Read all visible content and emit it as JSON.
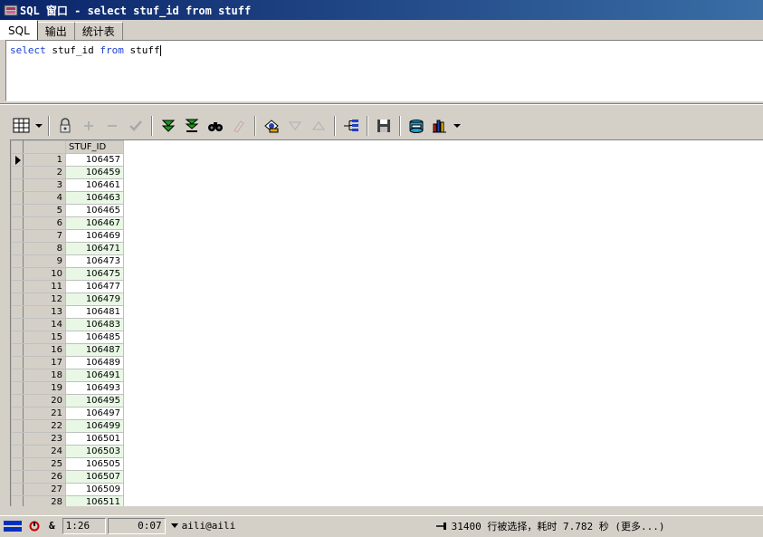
{
  "window": {
    "title": "SQL 窗口 - select stuf_id from stuff"
  },
  "tabs": [
    {
      "label": "SQL",
      "active": true
    },
    {
      "label": "输出",
      "active": false
    },
    {
      "label": "统计表",
      "active": false
    }
  ],
  "editor": {
    "kw_select": "select",
    "ident_col": "stuf_id",
    "kw_from": "from",
    "ident_table": "stuff"
  },
  "toolbar": {
    "icons": [
      "grid-view-icon",
      "dropdown-arrow-icon",
      "lock-icon",
      "add-record-icon",
      "delete-record-icon",
      "post-changes-icon",
      "fetch-next-page-icon",
      "fetch-last-page-icon",
      "find-icon",
      "clear-icon",
      "query-by-example-icon",
      "sort-descending-icon",
      "sort-ascending-icon",
      "link-icon",
      "save-icon",
      "export-icon",
      "chart-icon",
      "dropdown-arrow-icon"
    ]
  },
  "grid": {
    "column_header": "STUF_ID",
    "rows": [
      {
        "n": "1",
        "v": "106457"
      },
      {
        "n": "2",
        "v": "106459"
      },
      {
        "n": "3",
        "v": "106461"
      },
      {
        "n": "4",
        "v": "106463"
      },
      {
        "n": "5",
        "v": "106465"
      },
      {
        "n": "6",
        "v": "106467"
      },
      {
        "n": "7",
        "v": "106469"
      },
      {
        "n": "8",
        "v": "106471"
      },
      {
        "n": "9",
        "v": "106473"
      },
      {
        "n": "10",
        "v": "106475"
      },
      {
        "n": "11",
        "v": "106477"
      },
      {
        "n": "12",
        "v": "106479"
      },
      {
        "n": "13",
        "v": "106481"
      },
      {
        "n": "14",
        "v": "106483"
      },
      {
        "n": "15",
        "v": "106485"
      },
      {
        "n": "16",
        "v": "106487"
      },
      {
        "n": "17",
        "v": "106489"
      },
      {
        "n": "18",
        "v": "106491"
      },
      {
        "n": "19",
        "v": "106493"
      },
      {
        "n": "20",
        "v": "106495"
      },
      {
        "n": "21",
        "v": "106497"
      },
      {
        "n": "22",
        "v": "106499"
      },
      {
        "n": "23",
        "v": "106501"
      },
      {
        "n": "24",
        "v": "106503"
      },
      {
        "n": "25",
        "v": "106505"
      },
      {
        "n": "26",
        "v": "106507"
      },
      {
        "n": "27",
        "v": "106509"
      },
      {
        "n": "28",
        "v": "106511"
      }
    ]
  },
  "status": {
    "cursor_pos": "1:26",
    "elapsed": "0:07",
    "connection": "aili@aili",
    "message": "31400 行被选择，耗时 7.782 秒 (更多...)"
  },
  "colors": {
    "title_start": "#0a246a",
    "title_end": "#3a6ea5",
    "keyword": "#1c3fd1",
    "even_row": "#e8f8e4"
  }
}
